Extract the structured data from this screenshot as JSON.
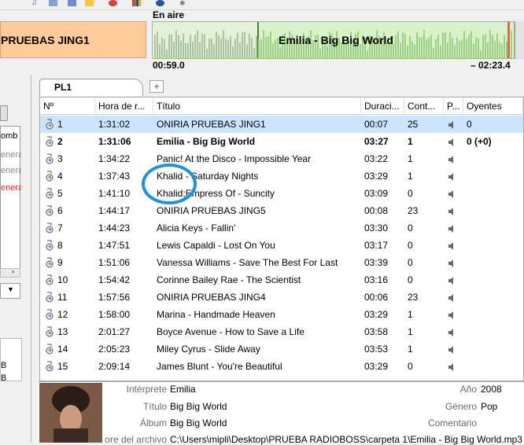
{
  "player": {
    "prev_track": "PRUEBAS JING1",
    "on_air_label": "En aire",
    "current_track": "Emilia - Big Big World",
    "elapsed": "00:59.0",
    "remaining": "– 02:23.4",
    "progress_fraction": 0.29
  },
  "left_panel": {
    "items": [
      "omb",
      "enera",
      "enera",
      "enera"
    ],
    "bottom_items": [
      "B",
      "B",
      "B"
    ]
  },
  "tabs": {
    "active": "PL1",
    "add": "+"
  },
  "columns": [
    "Nº",
    "Hora de r...",
    "Título",
    "Duraci...",
    "Cont...",
    "P...",
    "Oyentes"
  ],
  "rows": [
    {
      "n": "1",
      "time": "1:31:02",
      "title": "ONIRIA PRUEBAS JING1",
      "dur": "00:07",
      "count": "25",
      "listeners": "0",
      "state": "selected"
    },
    {
      "n": "2",
      "time": "1:31:06",
      "title": "Emilia - Big Big World",
      "dur": "03:27",
      "count": "1",
      "listeners": "0 (+0)",
      "state": "playing"
    },
    {
      "n": "3",
      "time": "1:34:22",
      "title": "Panic! At the Disco - Impossible Year",
      "dur": "03:22",
      "count": "1",
      "listeners": "",
      "state": ""
    },
    {
      "n": "4",
      "time": "1:37:43",
      "title": "Khalid - Saturday Nights",
      "dur": "03:29",
      "count": "1",
      "listeners": "",
      "state": ""
    },
    {
      "n": "5",
      "time": "1:41:10",
      "title": "Khalid;Empress Of - Suncity",
      "dur": "03:09",
      "count": "0",
      "listeners": "",
      "state": ""
    },
    {
      "n": "6",
      "time": "1:44:17",
      "title": "ONIRIA PRUEBAS JING5",
      "dur": "00:08",
      "count": "23",
      "listeners": "",
      "state": ""
    },
    {
      "n": "7",
      "time": "1:44:23",
      "title": "Alicia Keys - Fallin'",
      "dur": "03:30",
      "count": "0",
      "listeners": "",
      "state": ""
    },
    {
      "n": "8",
      "time": "1:47:51",
      "title": "Lewis Capaldi - Lost On You",
      "dur": "03:17",
      "count": "0",
      "listeners": "",
      "state": ""
    },
    {
      "n": "9",
      "time": "1:51:06",
      "title": "Vanessa Williams - Save The Best For Last",
      "dur": "03:39",
      "count": "0",
      "listeners": "",
      "state": ""
    },
    {
      "n": "10",
      "time": "1:54:42",
      "title": "Corinne Bailey Rae - The Scientist",
      "dur": "03:16",
      "count": "0",
      "listeners": "",
      "state": ""
    },
    {
      "n": "11",
      "time": "1:57:56",
      "title": "ONIRIA PRUEBAS JING4",
      "dur": "00:06",
      "count": "23",
      "listeners": "",
      "state": ""
    },
    {
      "n": "12",
      "time": "1:58:00",
      "title": "Marina - Handmade Heaven",
      "dur": "03:29",
      "count": "1",
      "listeners": "",
      "state": ""
    },
    {
      "n": "13",
      "time": "2:01:27",
      "title": "Boyce Avenue - How to Save a Life",
      "dur": "03:58",
      "count": "1",
      "listeners": "",
      "state": ""
    },
    {
      "n": "14",
      "time": "2:05:23",
      "title": "Miley Cyrus - Slide Away",
      "dur": "03:53",
      "count": "1",
      "listeners": "",
      "state": ""
    },
    {
      "n": "15",
      "time": "2:09:14",
      "title": "James Blunt - You're Beautiful",
      "dur": "03:29",
      "count": "0",
      "listeners": "",
      "state": ""
    }
  ],
  "info": {
    "artist_label": "Intérprete",
    "artist": "Emilia",
    "title_label": "Título",
    "title": "Big Big World",
    "album_label": "Álbum",
    "album": "Big Big World",
    "year_label": "Año",
    "year": "2008",
    "genre_label": "Género",
    "genre": "Pop",
    "comment_label": "Comentario",
    "path_label": "ore del archivo",
    "path": "C:\\Users\\mipli\\Desktop\\PRUEBA RADIOBOSS\\carpeta 1\\Emilia - Big Big World.mp3"
  },
  "colors": {
    "selected_row": "#cce5ff",
    "annotation": "#1b95d6",
    "prev_block": "#ffcc99",
    "wave_bg": "#d9f2c9"
  }
}
